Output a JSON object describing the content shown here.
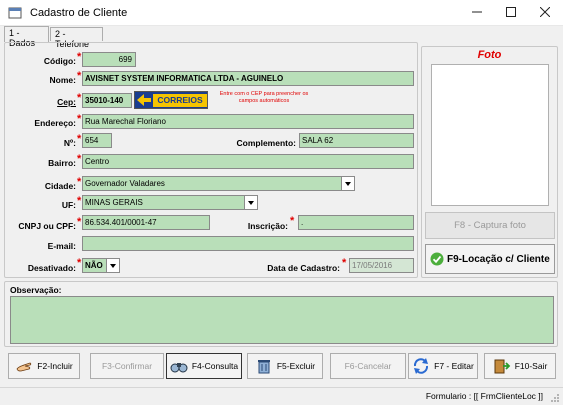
{
  "window": {
    "title": "Cadastro de Cliente",
    "minimize": "—",
    "maximize": "☐",
    "close": "✕"
  },
  "tabs": [
    {
      "label": "1 - Dados"
    },
    {
      "label": "2 - Telefone"
    }
  ],
  "form": {
    "codigo": {
      "label": "Código:",
      "value": "699"
    },
    "nome": {
      "label": "Nome:",
      "value": "AVISNET SYSTEM INFORMATICA LTDA - AGUINELO"
    },
    "cep": {
      "label": "Cep:",
      "value": "35010-140",
      "correios_logo": "CORREIOS",
      "hint": "Entre com o CEP para preencher os campos automáticos"
    },
    "endereco": {
      "label": "Endereço:",
      "value": "Rua Marechal Floriano"
    },
    "numero": {
      "label": "Nº:",
      "value": "654"
    },
    "complemento": {
      "label": "Complemento:",
      "value": "SALA 62"
    },
    "bairro": {
      "label": "Bairro:",
      "value": "Centro"
    },
    "cidade": {
      "label": "Cidade:",
      "value": "Governador Valadares"
    },
    "uf": {
      "label": "UF:",
      "value": "MINAS GERAIS"
    },
    "cnpj": {
      "label": "CNPJ ou CPF:",
      "value": "86.534.401/0001-47"
    },
    "inscricao": {
      "label": "Inscrição:",
      "value": "."
    },
    "email": {
      "label": "E-mail:",
      "value": ""
    },
    "desativado": {
      "label": "Desativado:",
      "value": "NÃO"
    },
    "data_cadastro": {
      "label": "Data de Cadastro:",
      "value": "17/05/2016"
    },
    "required_mark": "*"
  },
  "photo": {
    "title": "Foto",
    "capture_label": "F8 - Captura foto",
    "locacao_label": "F9-Locação c/ Cliente"
  },
  "observacao": {
    "label": "Observação:",
    "value": ""
  },
  "footer": {
    "incluir": "F2-Incluir",
    "confirmar": "F3-Confirmar",
    "consulta": "F4-Consulta",
    "excluir": "F5-Excluir",
    "cancelar": "F6-Cancelar",
    "editar": "F7 - Editar",
    "sair": "F10-Sair"
  },
  "status": {
    "text": "Formulario : [[ FrmClienteLoc ]]"
  },
  "colors": {
    "field_bg": "#b9dfb9",
    "required": "#e00000",
    "photo_title": "#e00000"
  }
}
